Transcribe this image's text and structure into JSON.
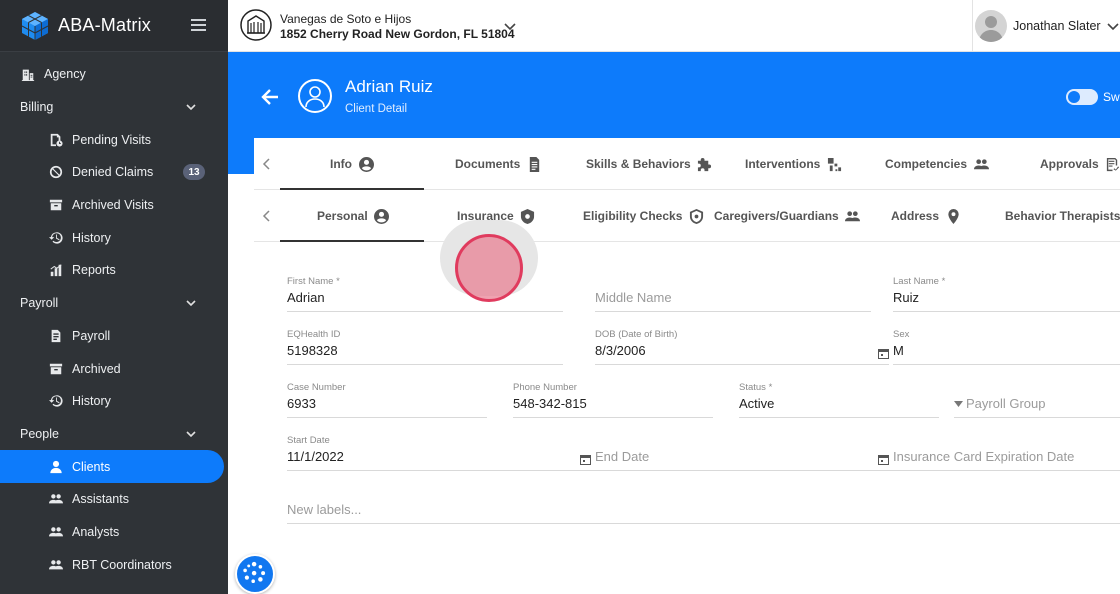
{
  "app": {
    "name": "ABA-Matrix"
  },
  "sidebar": {
    "items": [
      {
        "label": "Agency",
        "icon": "building-icon",
        "type": "top"
      },
      {
        "label": "Billing",
        "type": "section"
      },
      {
        "label": "Pending Visits",
        "icon": "document-clock-icon",
        "type": "sub"
      },
      {
        "label": "Denied Claims",
        "icon": "block-icon",
        "type": "sub",
        "badge": "13"
      },
      {
        "label": "Archived Visits",
        "icon": "archive-icon",
        "type": "sub"
      },
      {
        "label": "History",
        "icon": "history-icon",
        "type": "sub"
      },
      {
        "label": "Reports",
        "icon": "bar-chart-icon",
        "type": "sub"
      },
      {
        "label": "Payroll",
        "type": "section"
      },
      {
        "label": "Payroll",
        "icon": "payroll-icon",
        "type": "sub"
      },
      {
        "label": "Archived",
        "icon": "archive-icon",
        "type": "sub"
      },
      {
        "label": "History",
        "icon": "history-icon",
        "type": "sub"
      },
      {
        "label": "People",
        "type": "section"
      },
      {
        "label": "Clients",
        "icon": "person-icon",
        "type": "sub",
        "active": true
      },
      {
        "label": "Assistants",
        "icon": "people-icon",
        "type": "sub"
      },
      {
        "label": "Analysts",
        "icon": "people-icon",
        "type": "sub"
      },
      {
        "label": "RBT Coordinators",
        "icon": "people-icon",
        "type": "sub"
      }
    ]
  },
  "topbar": {
    "org_name": "Vanegas de Soto e Hijos",
    "org_address": "1852 Cherry Road New Gordon, FL 51804",
    "user_name": "Jonathan Slater"
  },
  "client": {
    "name": "Adrian Ruiz",
    "subtitle": "Client Detail",
    "switch_label": "Swi"
  },
  "tabs_primary": [
    {
      "label": "Info",
      "icon": "person-circle-icon",
      "active": true
    },
    {
      "label": "Documents",
      "icon": "document-icon"
    },
    {
      "label": "Skills & Behaviors",
      "icon": "puzzle-icon"
    },
    {
      "label": "Interventions",
      "icon": "interventions-icon"
    },
    {
      "label": "Competencies",
      "icon": "people-icon"
    },
    {
      "label": "Approvals",
      "icon": "approval-icon"
    }
  ],
  "tabs_secondary": [
    {
      "label": "Personal",
      "icon": "person-circle-icon",
      "active": true
    },
    {
      "label": "Insurance",
      "icon": "shield-icon"
    },
    {
      "label": "Eligibility Checks",
      "icon": "shield-check-icon"
    },
    {
      "label": "Caregivers/Guardians",
      "icon": "people-icon"
    },
    {
      "label": "Address",
      "icon": "location-pin-icon"
    },
    {
      "label": "Behavior Therapists",
      "icon": "people-icon"
    }
  ],
  "form": {
    "first_name": {
      "label": "First Name *",
      "value": "Adrian"
    },
    "middle_name": {
      "placeholder": "Middle Name"
    },
    "last_name": {
      "label": "Last Name *",
      "value": "Ruiz"
    },
    "eqhealth_id": {
      "label": "EQHealth ID",
      "value": "5198328"
    },
    "dob": {
      "label": "DOB (Date of Birth)",
      "value": "8/3/2006"
    },
    "sex": {
      "label": "Sex",
      "value": "M"
    },
    "case_number": {
      "label": "Case Number",
      "value": "6933"
    },
    "phone_number": {
      "label": "Phone Number",
      "value": "548-342-815"
    },
    "status": {
      "label": "Status *",
      "value": "Active"
    },
    "payroll_group": {
      "placeholder": "Payroll Group"
    },
    "start_date": {
      "label": "Start Date",
      "value": "11/1/2022"
    },
    "end_date": {
      "placeholder": "End Date"
    },
    "insurance_card_expiration": {
      "placeholder": "Insurance Card Expiration Date"
    },
    "labels": {
      "placeholder": "New labels..."
    }
  },
  "colors": {
    "accent": "#0d7bfb",
    "sidebar_bg": "#2f3337",
    "click_marker": "#e03b5e"
  }
}
